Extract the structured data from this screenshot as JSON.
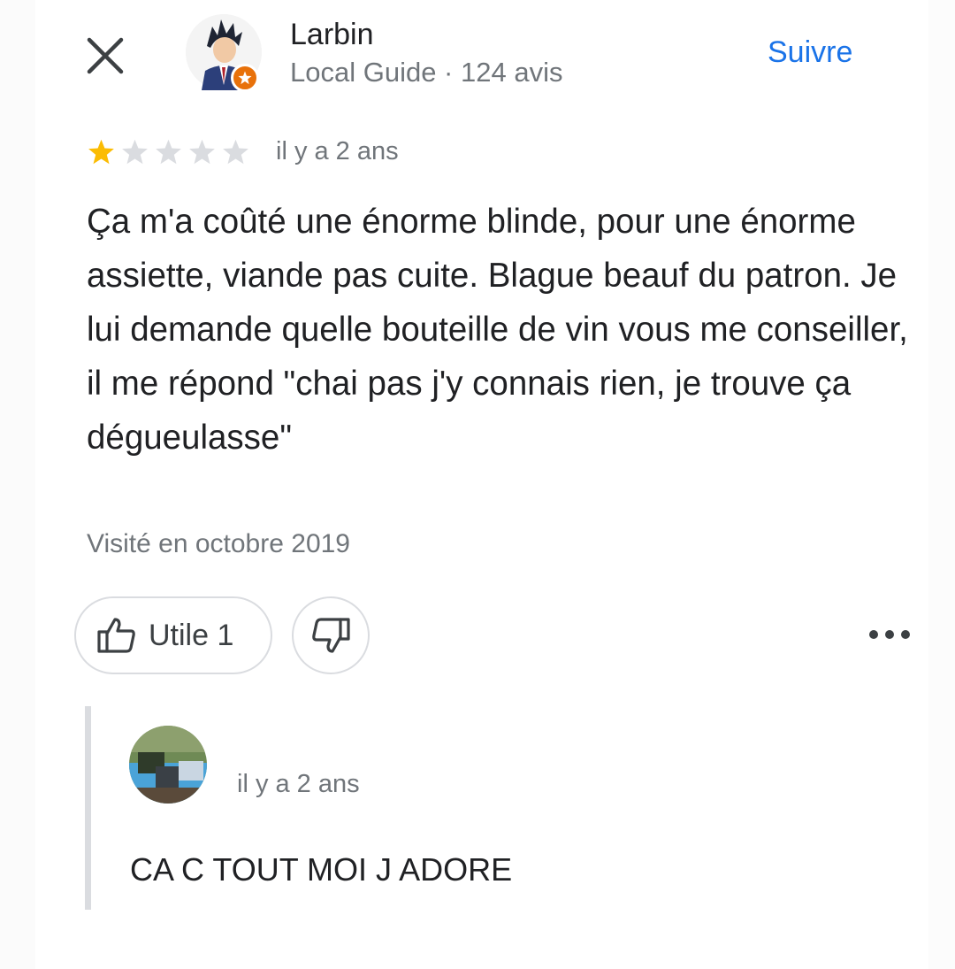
{
  "header": {
    "close_icon": "close-icon",
    "author_name": "Larbin",
    "author_meta": "Local Guide · 124 avis",
    "follow_label": "Suivre",
    "avatar_icon": "user-avatar",
    "badge_icon": "local-guide-star-icon"
  },
  "review": {
    "rating": 1,
    "max_rating": 5,
    "date": "il y a 2 ans",
    "text": "Ça m'a coûté une énorme blinde, pour une énorme assiette, viande pas cuite. Blague beauf du patron. Je lui demande quelle bouteille de vin vous me conseiller, il me répond \"chai pas j'y connais rien, je trouve ça dégueulasse\"",
    "visited": "Visité en octobre 2019"
  },
  "actions": {
    "useful_label": "Utile 1",
    "useful_icon": "thumbs-up-icon",
    "dislike_icon": "thumbs-down-icon",
    "more_icon": "more-horizontal-icon"
  },
  "reply": {
    "date": "il y a 2 ans",
    "text": "CA C TOUT MOI J ADORE"
  },
  "colors": {
    "accent": "#1a73e8",
    "star_filled": "#fbbc04",
    "star_empty": "#dadce0",
    "secondary_text": "#70757a",
    "badge": "#e8710a"
  }
}
